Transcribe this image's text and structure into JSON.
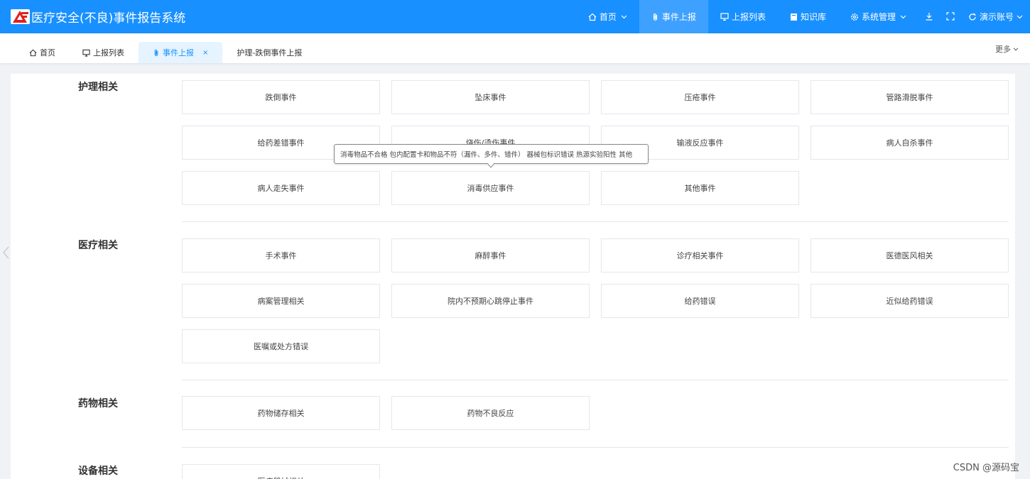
{
  "header": {
    "logo_icon": "alert-triangle-logo",
    "app_title": "医疗安全(不良)事件报告系统",
    "nav": {
      "home": "首页",
      "event_report": "事件上报",
      "report_list": "上报列表",
      "knowledge_base": "知识库",
      "system_admin": "系统管理"
    },
    "account": "演示账号",
    "bg_color": "#1890ff"
  },
  "tabs": {
    "home": "首页",
    "report_list": "上报列表",
    "event_report": "事件上报",
    "fall_report": "护理-跌倒事件上报",
    "more": "更多",
    "close_glyph": "×"
  },
  "sections": {
    "nursing": {
      "label": "护理相关",
      "items": [
        "跌倒事件",
        "坠床事件",
        "压疮事件",
        "管路滑脱事件",
        "给药差错事件",
        "烧伤/烫伤事件",
        "输液反应事件",
        "病人自杀事件",
        "病人走失事件",
        "消毒供应事件",
        "其他事件"
      ]
    },
    "medical": {
      "label": "医疗相关",
      "items": [
        "手术事件",
        "麻醉事件",
        "诊疗相关事件",
        "医德医风相关",
        "病案管理相关",
        "院内不预期心跳停止事件",
        "给药错误",
        "近似给药错误",
        "医嘱或处方错误"
      ]
    },
    "drug": {
      "label": "药物相关",
      "items": [
        "药物储存相关",
        "药物不良反应"
      ]
    },
    "equipment": {
      "label": "设备相关",
      "items": [
        "医疗器械相关"
      ]
    }
  },
  "tooltip": {
    "text": "消毒物品不合格 包内配置卡和物品不符（漏件、多件、错件） 器械包标识错误 热源实验阳性 其他"
  },
  "watermark": "CSDN @源码宝"
}
